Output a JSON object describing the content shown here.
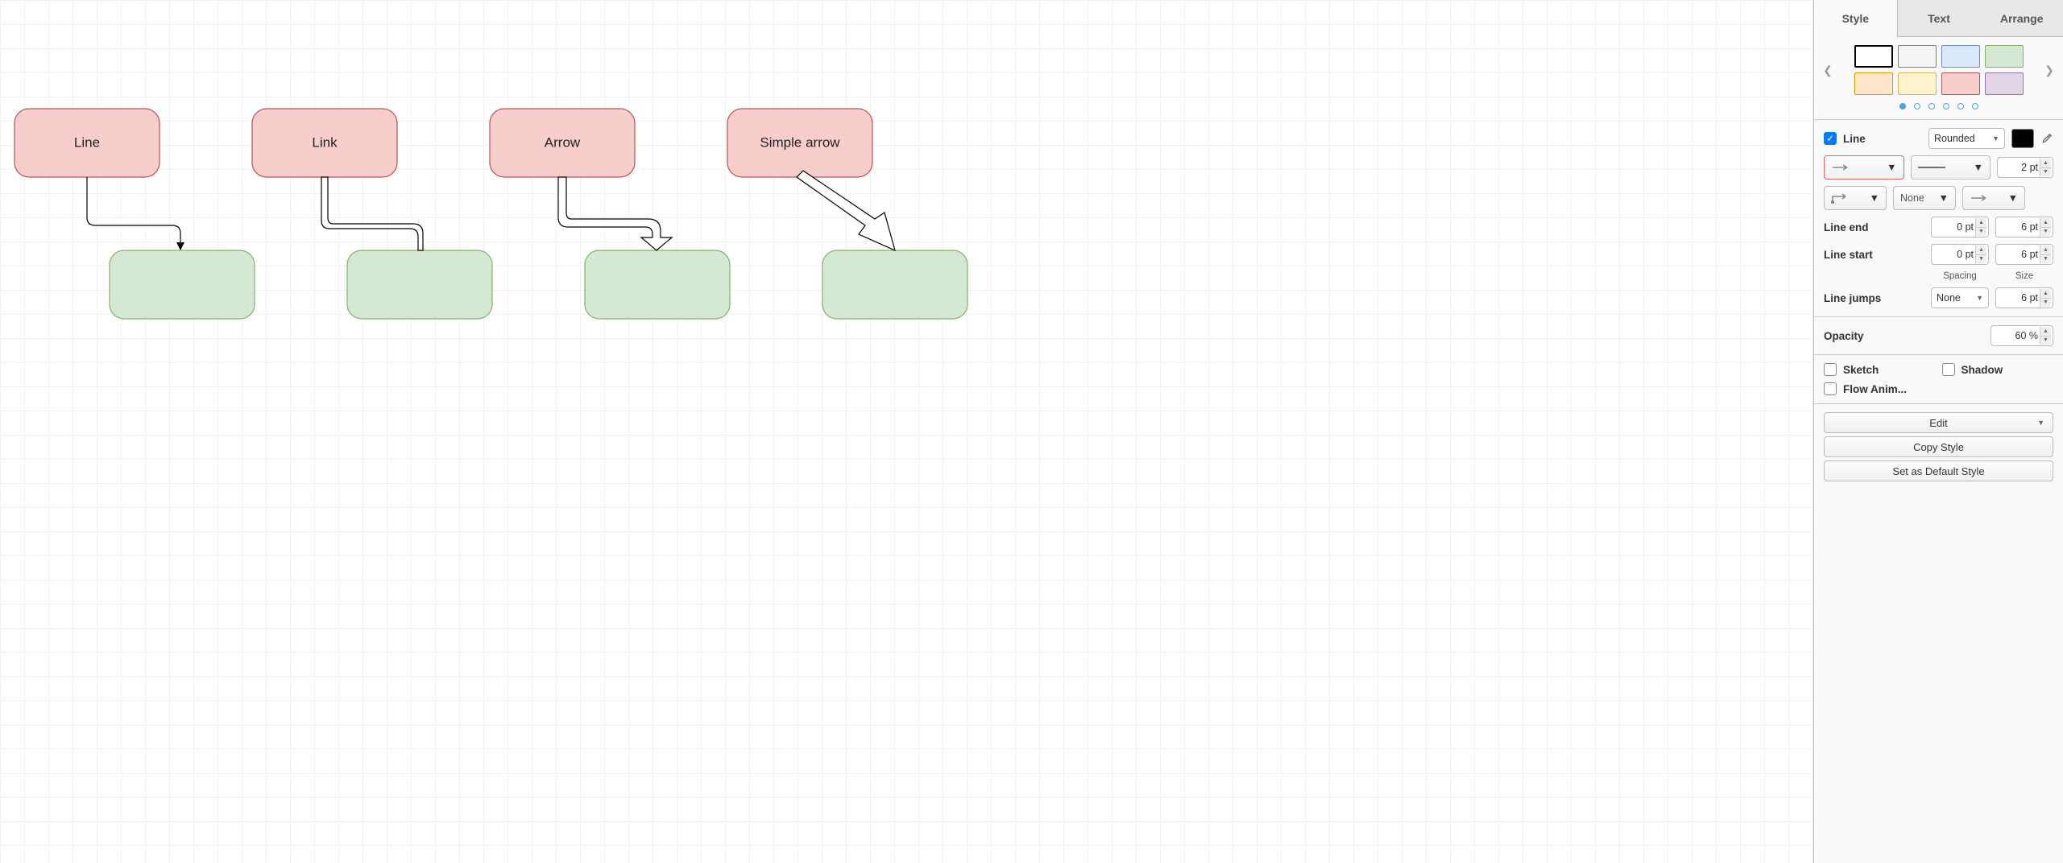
{
  "canvas": {
    "nodes": [
      {
        "id": "line",
        "label": "Line"
      },
      {
        "id": "link",
        "label": "Link"
      },
      {
        "id": "arrow",
        "label": "Arrow"
      },
      {
        "id": "simple",
        "label": "Simple arrow"
      }
    ]
  },
  "sidebar": {
    "tabs": {
      "style": "Style",
      "text": "Text",
      "arrange": "Arrange"
    },
    "palette_colors": [
      {
        "fill": "#ffffff",
        "stroke": "#000000"
      },
      {
        "fill": "#f5f5f5",
        "stroke": "#808080"
      },
      {
        "fill": "#dae8fc",
        "stroke": "#6c8ebf"
      },
      {
        "fill": "#d5e8d4",
        "stroke": "#82b366"
      },
      {
        "fill": "#ffe6cc",
        "stroke": "#d79b00"
      },
      {
        "fill": "#fff2cc",
        "stroke": "#d6b656"
      },
      {
        "fill": "#f8cecc",
        "stroke": "#b85450"
      },
      {
        "fill": "#e1d5e7",
        "stroke": "#9673a6"
      }
    ],
    "line": {
      "checkbox_label": "Line",
      "style_value": "Rounded",
      "color": "#000000",
      "width_value": "2 pt",
      "waypoint_value": "None",
      "lineend_label": "Line end",
      "linestart_label": "Line start",
      "end_spacing": "0 pt",
      "end_size": "6 pt",
      "start_spacing": "0 pt",
      "start_size": "6 pt",
      "spacing_head": "Spacing",
      "size_head": "Size",
      "linejumps_label": "Line jumps",
      "linejumps_value": "None",
      "linejumps_size": "6 pt"
    },
    "opacity": {
      "label": "Opacity",
      "value": "60 %"
    },
    "effects": {
      "sketch": "Sketch",
      "shadow": "Shadow",
      "flow": "Flow Anim..."
    },
    "buttons": {
      "edit": "Edit",
      "copy": "Copy Style",
      "default": "Set as Default Style"
    }
  }
}
